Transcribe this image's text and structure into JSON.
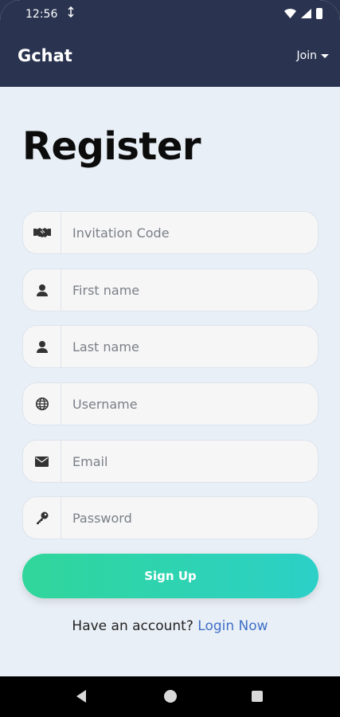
{
  "status_bar": {
    "time": "12:56"
  },
  "header": {
    "app_name": "Gchat",
    "menu_label": "Join"
  },
  "page_title": "Register",
  "form": {
    "invitation_code": {
      "placeholder": "Invitation Code",
      "value": ""
    },
    "first_name": {
      "placeholder": "First name",
      "value": ""
    },
    "last_name": {
      "placeholder": "Last name",
      "value": ""
    },
    "username": {
      "placeholder": "Username",
      "value": ""
    },
    "email": {
      "placeholder": "Email",
      "value": ""
    },
    "password": {
      "placeholder": "Password",
      "value": ""
    },
    "submit_label": "Sign Up"
  },
  "footer": {
    "prompt": "Have an account?",
    "link": "Login Now"
  },
  "icons": {
    "invitation": "handshake-icon",
    "first_name": "user-icon",
    "last_name": "user-icon",
    "username": "globe-icon",
    "email": "envelope-icon",
    "password": "key-icon"
  },
  "colors": {
    "header_bg": "#2a3450",
    "page_bg": "#e9eff6",
    "button_start": "#30d69a",
    "button_end": "#2cd0c7",
    "link": "#3f6fc7"
  }
}
